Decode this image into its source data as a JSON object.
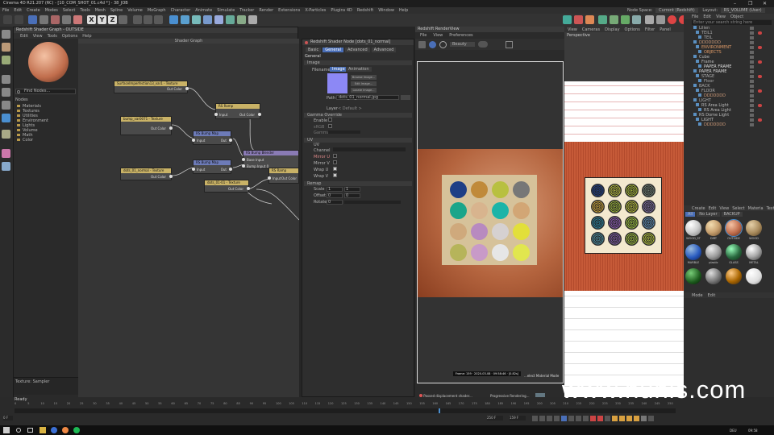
{
  "window": {
    "title": "Cinema 4D R21.207 (RC) - [10_COM_SHOT_01.c4d *] - 38_JOB",
    "controls": [
      "–",
      "❐",
      "✕"
    ]
  },
  "menu": [
    "File",
    "Edit",
    "Create",
    "Modes",
    "Select",
    "Tools",
    "Mesh",
    "Spline",
    "Volume",
    "MoGraph",
    "Character",
    "Animate",
    "Simulate",
    "Tracker",
    "Render",
    "Extensions",
    "X-Particles",
    "Plugins 4D",
    "Redshift",
    "Window",
    "Help"
  ],
  "node_space": {
    "label": "Node Space:",
    "value": "Current (Redshift)",
    "layout_label": "Layout:",
    "layout_value": "RS_VOLUME (User)"
  },
  "shader_graph": {
    "window_title": "Redshift Shader Graph - OUTSIDE",
    "menu": [
      "Edit",
      "View",
      "Tools",
      "Options",
      "Help"
    ],
    "header": "Shader Graph",
    "find_nodes": "Find Nodes...",
    "nodes_label": "Nodes",
    "categories": [
      "Materials",
      "Textures",
      "Utilities",
      "Environment",
      "Lights",
      "Volume",
      "Math",
      "Color"
    ],
    "status": "Texture: Sampler",
    "nodes": [
      {
        "title": "SurfaceImperfection13_var1 - Texture",
        "port": "Out Color"
      },
      {
        "title": "bump_var0071 - Texture",
        "port": "Out Color"
      },
      {
        "title": "RS Ramp",
        "in": "Input",
        "out": "Out Color"
      },
      {
        "title": "RS Bump Map",
        "in": "Input",
        "out": "Out"
      },
      {
        "title": "RS Bump Map",
        "in": "Input",
        "out": "Out"
      },
      {
        "title": "RS Bump Blender",
        "in1": "Base Input",
        "in2": "Bump Input 0"
      },
      {
        "title": "dots_01_normal - Texture",
        "port": "Out Color"
      },
      {
        "title": "dots_01-01 - Texture",
        "port": "Out Color"
      },
      {
        "title": "RS Ramp",
        "in": "Input",
        "out": "Out Color"
      }
    ]
  },
  "attributes": {
    "title": "Redshift Shader Node [dots_01_normal]",
    "tabs": [
      "Basic",
      "General",
      "Advanced",
      "Advanced"
    ],
    "section": "General",
    "image_label": "Image",
    "filename_label": "Filename",
    "image_tab": "Image",
    "animation_tab": "Animation",
    "buttons": [
      "Browse Image...",
      "Edit Image...",
      "Locate Image..."
    ],
    "path_label": "Path",
    "path_value": "dots_01_normal.jpg",
    "layer_label": "Layer",
    "layer_value": "< Default >",
    "gamma_header": "Gamma Override",
    "enable": "Enable",
    "sRGB": "sRGB",
    "gamma": "Gamma",
    "uv_header": "UV",
    "uv_channel": "UV Channel",
    "mirror_u": "Mirror U",
    "mirror_v": "Mirror V",
    "wrap_u": "Wrap U",
    "wrap_v": "Wrap V",
    "remap_header": "Remap",
    "scale": "Scale",
    "scale_u": "1",
    "scale_v": "1",
    "offset": "Offset",
    "offset_u": "0",
    "offset_v": "0",
    "rotate": "Rotate",
    "rotate_v": "0"
  },
  "renderview": {
    "title": "Redshift RenderView",
    "menu": [
      "File",
      "View",
      "Preferences"
    ],
    "beauty": "Beauty",
    "frame_info": "Frame: 159 · 2020-03-08 · 09:58:46 · [0.82s]",
    "hint": "...elect Material Mode",
    "progress": "Progressive Rendering...",
    "status": "Passed displacement shader..."
  },
  "viewport": {
    "menu": [
      "View",
      "Cameras",
      "Display",
      "Options",
      "Filter",
      "Panel"
    ],
    "label": "Perspective"
  },
  "objects": {
    "tabs": [
      "File",
      "Edit",
      "View",
      "Object"
    ],
    "search": "Enter your search string here",
    "items": [
      "Lilien",
      "TEIL1",
      "TEIL",
      "DDDDDDD",
      "ENVIRONMENT",
      "OBJECTS",
      "Cube",
      "Frame",
      "PAPER FRAME",
      "PAPER FRAME",
      "STAGE",
      "Floor",
      "BACK",
      "FLOOR",
      "DDDDDDD",
      "LIGHT",
      "RS Area Light",
      "RS Area Light",
      "RS Dome Light",
      "LIGHT",
      "DDDDDDD"
    ]
  },
  "materials": {
    "menu": [
      "Create",
      "Edit",
      "View",
      "Select",
      "Materia",
      "Texture"
    ],
    "filters": [
      "All",
      "No Layer",
      "BACKUP"
    ],
    "items": [
      "WOOD_ST",
      "DIRT",
      "OUTSIDE",
      "WOOD",
      "MARBLE",
      "plastic",
      "GLASS",
      "METAL",
      "",
      "",
      "",
      ""
    ],
    "mode_menu": [
      "Mode",
      "Edit"
    ]
  },
  "timeline": {
    "ticks": [
      "0",
      "5",
      "10",
      "15",
      "20",
      "25",
      "30",
      "35",
      "40",
      "45",
      "50",
      "55",
      "60",
      "65",
      "70",
      "75",
      "80",
      "85",
      "90",
      "95",
      "100",
      "105",
      "110",
      "115",
      "120",
      "125",
      "130",
      "135",
      "140",
      "145",
      "150",
      "155",
      "160",
      "165",
      "170",
      "175",
      "180",
      "185",
      "190",
      "195",
      "200",
      "205",
      "210",
      "215",
      "220",
      "225",
      "230",
      "235",
      "240",
      "245",
      "250"
    ],
    "start": "0 F",
    "end": "250 F",
    "current": "159 F",
    "ready": "Ready"
  },
  "taskbar": {
    "time": "09:58",
    "lang": "DEU"
  },
  "watermark": "www.hunls.com",
  "colors": {
    "node_yellow": "#c9b266",
    "node_blue": "#6d7bb8",
    "node_purple": "#8a7bb5",
    "accent": "#4a6fb8",
    "preview_blue": "#8c88f5"
  }
}
